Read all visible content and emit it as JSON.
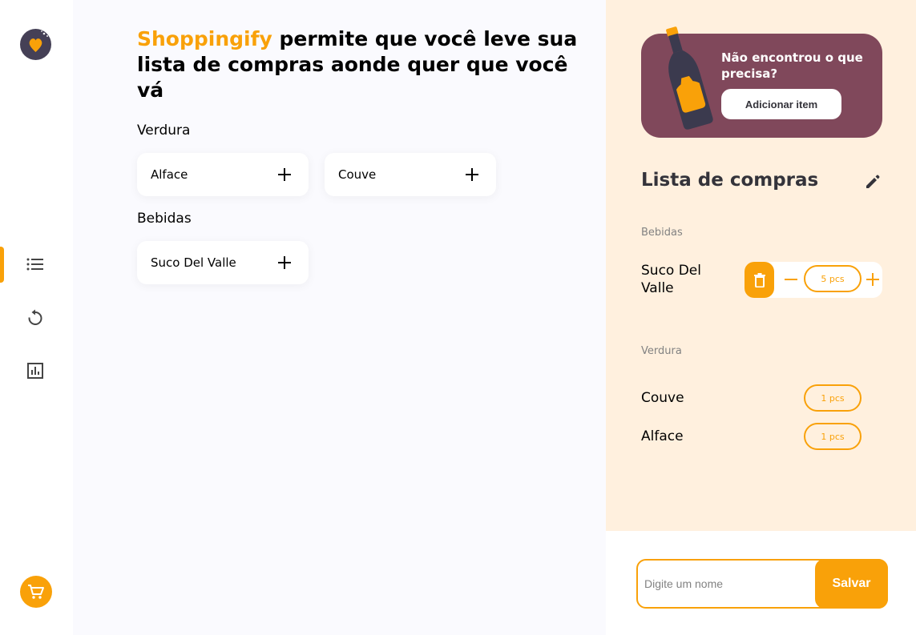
{
  "app": {
    "brand": "Shoppingify",
    "headline_rest": " permite que você leve sua lista de compras aonde quer que você vá",
    "accent_color": "#F9A109"
  },
  "sidebar": {
    "logo_icon": "logo-icon",
    "items": [
      {
        "name": "list-icon",
        "active": true
      },
      {
        "name": "history-icon",
        "active": false
      },
      {
        "name": "statistics-icon",
        "active": false
      }
    ],
    "cart_icon": "cart-icon"
  },
  "categories": [
    {
      "title": "Verdura",
      "items": [
        {
          "name": "Alface"
        },
        {
          "name": "Couve"
        }
      ]
    },
    {
      "title": "Bebidas",
      "items": [
        {
          "name": "Suco Del Valle"
        }
      ]
    }
  ],
  "promo": {
    "text": "Não encontrou o que precisa?",
    "button_label": "Adicionar item",
    "background": "#80485B"
  },
  "shopping_list": {
    "title": "Lista de compras",
    "groups": [
      {
        "title": "Bebidas",
        "items": [
          {
            "name": "Suco Del Valle",
            "qty": "5 pcs",
            "editing": true
          }
        ]
      },
      {
        "title": "Verdura",
        "items": [
          {
            "name": "Couve",
            "qty": "1 pcs"
          },
          {
            "name": "Alface",
            "qty": "1 pcs"
          }
        ]
      }
    ]
  },
  "name_form": {
    "placeholder": "Digite um nome",
    "save_label": "Salvar"
  }
}
